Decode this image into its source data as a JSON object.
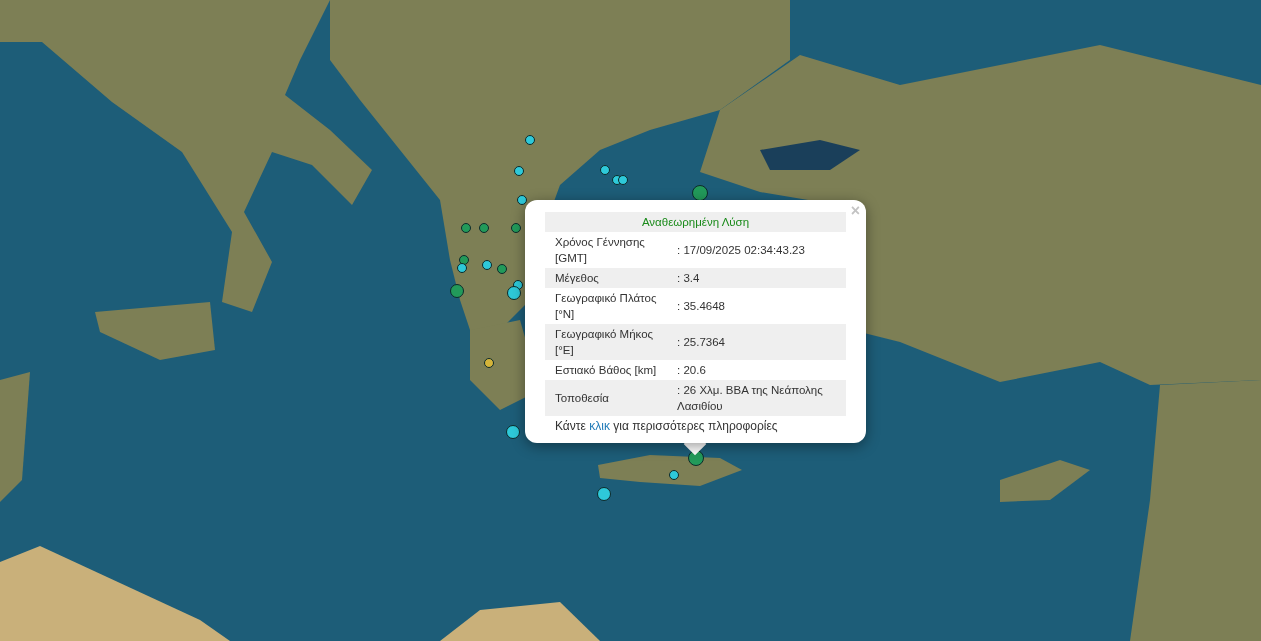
{
  "markers": [
    {
      "color": "#2ec9d9"
    },
    {
      "color": "#2ec9d9"
    },
    {
      "color": "#2ec9d9"
    },
    {
      "color": "#2ec9d9"
    },
    {
      "color": "#2ec9d9"
    },
    {
      "color": "#2ec9d9"
    },
    {
      "color": "#229a5a"
    },
    {
      "color": "#229a5a"
    },
    {
      "color": "#229a5a"
    },
    {
      "color": "#229a5a"
    },
    {
      "color": "#229a5a"
    },
    {
      "color": "#229a5a"
    },
    {
      "color": "#2ec9d9"
    },
    {
      "color": "#2ec9d9"
    },
    {
      "color": "#229a5a"
    },
    {
      "color": "#2ec9d9"
    },
    {
      "color": "#2ec9d9"
    },
    {
      "color": "#d4b43a"
    },
    {
      "color": "#2ec9d9"
    },
    {
      "color": "#229a5a"
    },
    {
      "color": "#2ec9d9"
    },
    {
      "color": "#2ec9d9"
    }
  ],
  "popup": {
    "close": "×",
    "title": "Αναθεωρημένη Λύση",
    "rows": [
      {
        "label": "Χρόνος Γέννησης [GMT]",
        "value": ": 17/09/2025 02:34:43.23"
      },
      {
        "label": "Μέγεθος",
        "value": ": 3.4"
      },
      {
        "label": "Γεωγραφικό Πλάτος [°N]",
        "value": ": 35.4648"
      },
      {
        "label": "Γεωγραφικό Μήκος [°E]",
        "value": ": 25.7364"
      },
      {
        "label": "Εστιακό Βάθος [km]",
        "value": ": 20.6"
      },
      {
        "label": "Τοποθεσία",
        "value": ": 26 Χλμ. ΒΒΑ της Νεάπολης Λασιθίου"
      }
    ],
    "footer": {
      "before": "Κάντε",
      "link": "κλικ",
      "after": "για περισσότερες πληροφορίες"
    }
  }
}
